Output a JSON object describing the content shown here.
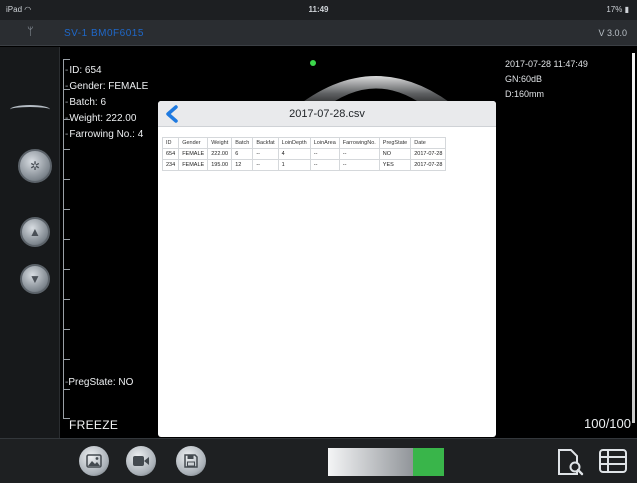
{
  "status_bar": {
    "device": "iPad",
    "time": "11:49",
    "battery": "17%"
  },
  "header": {
    "device_name": "SV-1 BM0F6015",
    "version": "V 3.0.0"
  },
  "patient": {
    "id": "ID: 654",
    "gender": "Gender: FEMALE",
    "batch": "Batch: 6",
    "weight": "Weight: 222.00",
    "farrowing": "Farrowing No.: 4",
    "preg_state": "PregState: NO"
  },
  "scan": {
    "datetime": "2017-07-28 11:47:49",
    "gain": "GN:60dB",
    "depth": "D:160mm",
    "freeze_label": "FREEZE",
    "frame_counter": "100/100"
  },
  "dialog": {
    "title": "2017-07-28.csv",
    "columns": [
      "ID",
      "Gender",
      "Weight",
      "Batch",
      "Backfat",
      "LoinDepth",
      "LoinArea",
      "FarrowingNo.",
      "PregState",
      "Date"
    ],
    "rows": [
      [
        "654",
        "FEMALE",
        "222.00",
        "6",
        "--",
        "4",
        "--",
        "--",
        "NO",
        "2017-07-28"
      ],
      [
        "234",
        "FEMALE",
        "195.00",
        "12",
        "--",
        "1",
        "--",
        "--",
        "YES",
        "2017-07-28"
      ]
    ]
  },
  "toolbar": {
    "gain_level": 0.27
  },
  "colors": {
    "accent_blue": "#1f68c9",
    "gain_green": "#39b54a",
    "probe_dot": "#3cd64b"
  },
  "icons": {
    "status": [
      "wifi-icon",
      "battery-icon"
    ],
    "sidebar": [
      "logo",
      "focus-icon",
      "chevron-up-icon",
      "chevron-down-icon"
    ],
    "toolbar": [
      "image-icon",
      "video-camera-icon",
      "floppy-disk-icon",
      "file-search-icon",
      "list-icon"
    ]
  }
}
